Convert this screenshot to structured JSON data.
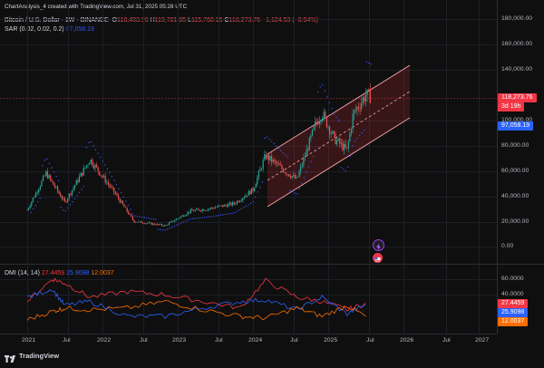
{
  "meta": {
    "author_line": "ChartAnalysis_4 created with TradingView.com, Jul 31, 2025 05:28 UTC"
  },
  "legend": {
    "symbol": "Bitcoin / U.S. Dollar · 1W · BINANCE",
    "open_label": "O",
    "open": "118,403.99",
    "high_label": "H",
    "high": "119,781.85",
    "low_label": "L",
    "low": "115,760.15",
    "close_label": "C",
    "close": "118,273.76",
    "change": "−1,124.53 (−0.94%)",
    "sar_label": "SAR (0.02, 0.02, 0.2)",
    "sar_value": "97,058.19"
  },
  "price_axis": {
    "ticks": [
      "180,000.00",
      "160,000.00",
      "140,000.00",
      "100,000.00",
      "80,000.00",
      "60,000.00",
      "40,000.00",
      "20,000.00",
      "0.00"
    ],
    "last_price": "118,273.76",
    "countdown": "3d 19h",
    "sar_badge": "97,058.19"
  },
  "dmi": {
    "label": "DMI (14, 14)",
    "adx": "27.4459",
    "plus_di": "25.9098",
    "minus_di": "12.0037",
    "ticks": [
      "60.0000",
      "40.0000"
    ],
    "badges": [
      "27.4459",
      "25.9098",
      "12.0037"
    ]
  },
  "time_axis": {
    "labels": [
      "2021",
      "Jul",
      "2022",
      "Jul",
      "2023",
      "Jul",
      "2024",
      "Jul",
      "2025",
      "Jul",
      "2026",
      "Jul",
      "2027"
    ]
  },
  "brand": {
    "name": "TradingView"
  },
  "colors": {
    "background": "#0f0f0f",
    "up": "#26a69a",
    "down": "#ef5350",
    "sar": "#3355ff",
    "channel": "#f7a1ab",
    "adx": "#f23645",
    "plus_di": "#2962ff",
    "minus_di": "#ff6d00"
  },
  "icons": [
    "lightning-icon",
    "flag-icon",
    "tradingview-logo-icon"
  ],
  "chart_data": [
    {
      "type": "line",
      "title": "Bitcoin / U.S. Dollar · 1W · BINANCE",
      "xlabel": "",
      "ylabel": "",
      "ylim": [
        0,
        180000
      ],
      "grid": true,
      "x": [
        "2021-01",
        "2021-04",
        "2021-07",
        "2021-11",
        "2022-03",
        "2022-06",
        "2022-11",
        "2023-03",
        "2023-06",
        "2023-10",
        "2024-01",
        "2024-03",
        "2024-06",
        "2024-08",
        "2024-11",
        "2024-12",
        "2025-02",
        "2025-04",
        "2025-05",
        "2025-07",
        "2025-07-28"
      ],
      "series": [
        {
          "name": "BTCUSDT",
          "values": [
            29000,
            58000,
            35000,
            69000,
            42000,
            20000,
            16500,
            28000,
            30000,
            34000,
            45000,
            72000,
            60000,
            53000,
            97000,
            106000,
            85000,
            76000,
            105000,
            120000,
            118273.76
          ]
        }
      ]
    },
    {
      "type": "line",
      "title": "DMI (14, 14)",
      "xlabel": "",
      "ylabel": "",
      "ylim": [
        0,
        70
      ],
      "x": [
        "2021-01",
        "2021-05",
        "2021-07",
        "2021-11",
        "2022-05",
        "2022-11",
        "2023-05",
        "2023-11",
        "2024-03",
        "2024-08",
        "2024-12",
        "2025-04",
        "2025-07"
      ],
      "series": [
        {
          "name": "ADX",
          "values": [
            30,
            57,
            52,
            35,
            42,
            38,
            30,
            22,
            55,
            35,
            30,
            20,
            27.4459
          ]
        },
        {
          "name": "+DI",
          "values": [
            35,
            45,
            25,
            30,
            12,
            12,
            22,
            30,
            32,
            20,
            35,
            15,
            25.9098
          ]
        },
        {
          "name": "-DI",
          "values": [
            8,
            18,
            22,
            20,
            22,
            30,
            20,
            12,
            10,
            22,
            12,
            25,
            12.0037
          ]
        }
      ]
    }
  ]
}
